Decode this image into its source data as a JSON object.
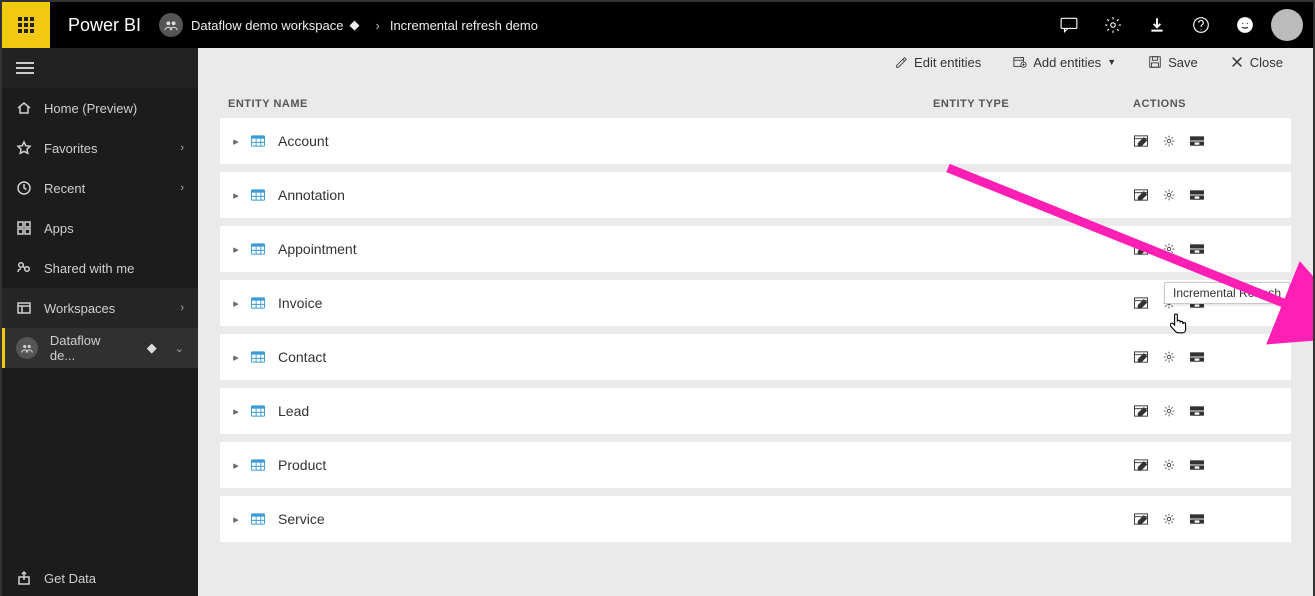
{
  "app": {
    "title": "Power BI"
  },
  "breadcrumb": {
    "workspace": "Dataflow demo workspace",
    "page": "Incremental refresh demo"
  },
  "toolbar": {
    "edit": "Edit entities",
    "add": "Add entities",
    "save": "Save",
    "close": "Close"
  },
  "leftnav": {
    "home": "Home (Preview)",
    "favorites": "Favorites",
    "recent": "Recent",
    "apps": "Apps",
    "shared": "Shared with me",
    "workspaces": "Workspaces",
    "current_ws": "Dataflow de...",
    "getdata": "Get Data"
  },
  "columns": {
    "name": "ENTITY NAME",
    "type": "ENTITY TYPE",
    "actions": "ACTIONS"
  },
  "entities": [
    {
      "name": "Account"
    },
    {
      "name": "Annotation"
    },
    {
      "name": "Appointment"
    },
    {
      "name": "Invoice"
    },
    {
      "name": "Contact"
    },
    {
      "name": "Lead"
    },
    {
      "name": "Product"
    },
    {
      "name": "Service"
    }
  ],
  "tooltip": {
    "text": "Incremental Refresh"
  }
}
